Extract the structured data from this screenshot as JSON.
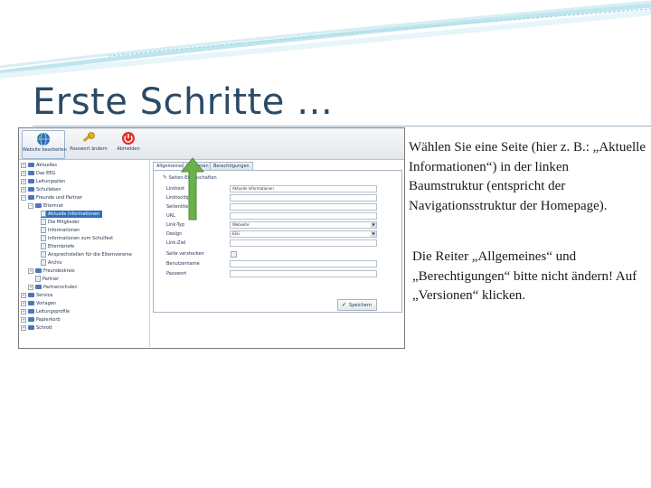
{
  "slide": {
    "title": "Erste Schritte …",
    "paragraph1": "Wählen Sie eine Seite (hier z. B.: „Aktuelle Informationen“) in der linken Baumstruktur (entspricht der Navigationsstruktur der Homepage).",
    "paragraph2": "Die Reiter „Allgemeines“ und „Berechtigungen“ bitte nicht ändern! Auf „Versionen“ klicken."
  },
  "colors": {
    "title": "#2b4a66",
    "selection": "#2f6fc0",
    "arrow": "#6ab04c",
    "folder": "#4b77b6"
  },
  "toolbar": {
    "buttons": [
      {
        "label": "Website bearbeiten",
        "icon": "globe-icon"
      },
      {
        "label": "Passwort ändern",
        "icon": "key-icon"
      },
      {
        "label": "Abmelden",
        "icon": "power-icon"
      }
    ]
  },
  "tree": {
    "items": [
      {
        "label": "Aktuelles",
        "type": "folder",
        "expander": "+"
      },
      {
        "label": "Das EEG",
        "type": "folder",
        "expander": "+"
      },
      {
        "label": "Leitungsplan",
        "type": "folder",
        "expander": "+"
      },
      {
        "label": "Schulleben",
        "type": "folder",
        "expander": "+"
      },
      {
        "label": "Freunde und Partner",
        "type": "folder",
        "expander": "−"
      },
      {
        "label": "Elternrat",
        "type": "folder",
        "expander": "−"
      },
      {
        "label": "Aktuelle Informationen",
        "type": "page",
        "selected": true
      },
      {
        "label": "Die Mitglieder",
        "type": "page"
      },
      {
        "label": "Informationen",
        "type": "page"
      },
      {
        "label": "Informationen zum Schulfest",
        "type": "page"
      },
      {
        "label": "Elternbriefe",
        "type": "page"
      },
      {
        "label": "Ansprechstellen für die Elternvereine",
        "type": "page"
      },
      {
        "label": "Archiv",
        "type": "page"
      },
      {
        "label": "Freundeskreis",
        "type": "folder",
        "expander": "+"
      },
      {
        "label": "Partner",
        "type": "page"
      },
      {
        "label": "Partnerschulen",
        "type": "folder",
        "expander": "+"
      },
      {
        "label": "Service",
        "type": "folder",
        "expander": "+"
      },
      {
        "label": "Vorlagen",
        "type": "folder",
        "expander": "+"
      },
      {
        "label": "Leitungsprofile",
        "type": "folder",
        "expander": "+"
      },
      {
        "label": "Papierkorb",
        "type": "folder",
        "expander": "+"
      },
      {
        "label": "Schrott",
        "type": "folder",
        "expander": "+"
      }
    ]
  },
  "tabs": [
    "Allgemeines",
    "Versionen",
    "Berechtigungen"
  ],
  "form": {
    "section_title": "Seiten-Eigenschaften",
    "fields": [
      {
        "label": "Linktext",
        "kind": "input",
        "value": "Aktuelle Informationen"
      },
      {
        "label": "Linktooltip",
        "kind": "input",
        "value": ""
      },
      {
        "label": "Seitentitel",
        "kind": "input",
        "value": ""
      },
      {
        "label": "URL",
        "kind": "input",
        "value": ""
      },
      {
        "label": "Link-Typ",
        "kind": "select",
        "value": "Webseite"
      },
      {
        "label": "Design",
        "kind": "select",
        "value": "EEG"
      },
      {
        "label": "Link-Ziel",
        "kind": "input",
        "value": ""
      },
      {
        "label": "Seite verstecken",
        "kind": "checkbox",
        "value": ""
      },
      {
        "label": "Benutzername",
        "kind": "input",
        "value": ""
      },
      {
        "label": "Passwort",
        "kind": "input",
        "value": ""
      }
    ],
    "save_label": "Speichern"
  }
}
